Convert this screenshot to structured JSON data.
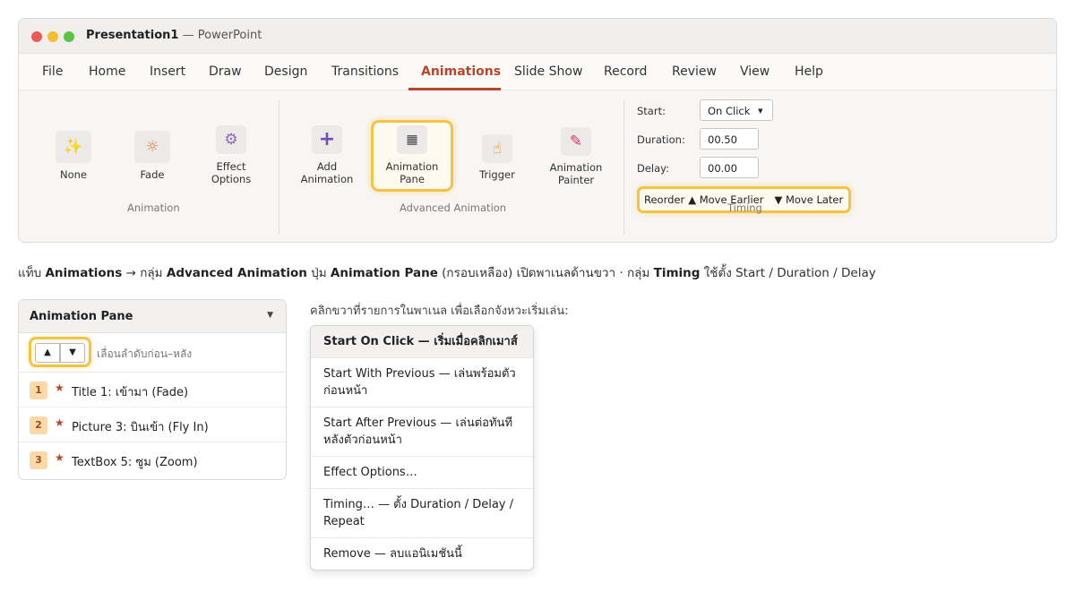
{
  "window": {
    "title": "Presentation1",
    "app_suffix": " — PowerPoint"
  },
  "tabs": [
    "File",
    "Home",
    "Insert",
    "Draw",
    "Design",
    "Transitions",
    "Animations",
    "Slide Show",
    "Record",
    "Review",
    "View",
    "Help"
  ],
  "active_tab": "Animations",
  "ribbon": {
    "animation_group": {
      "label": "Animation",
      "buttons": [
        {
          "label": "None",
          "icon": "sparkle-icon"
        },
        {
          "label": "Fade",
          "icon": "sun-icon"
        },
        {
          "label": "Effect Options",
          "icon": "gear-icon"
        }
      ]
    },
    "advanced_group": {
      "label": "Advanced Animation",
      "buttons": [
        {
          "label": "Add Animation",
          "icon": "plus-icon"
        },
        {
          "label": "Animation Pane",
          "icon": "grid-icon"
        },
        {
          "label": "Trigger",
          "icon": "hand-pointer-icon"
        },
        {
          "label": "Animation Painter",
          "icon": "brush-icon"
        }
      ]
    },
    "timing_group": {
      "label": "Timing",
      "start_label": "Start:",
      "start_value": "On Click",
      "duration_label": "Duration:",
      "duration_value": "00.50",
      "delay_label": "Delay:",
      "delay_value": "00.00",
      "reorder_label": "Reorder",
      "move_earlier": "▲ Move Earlier",
      "move_later": "▼ Move Later"
    }
  },
  "caption": {
    "p1": "แท็บ ",
    "b1": "Animations",
    "p2": " → กลุ่ม ",
    "b2": "Advanced Animation",
    "p3": " ปุ่ม ",
    "b3": "Animation Pane",
    "p4": " (กรอบเหลือง) เปิดพาเนลด้านขวา  ·  กลุ่ม ",
    "b4": "Timing",
    "p5": " ใช้ตั้ง Start / Duration / Delay"
  },
  "pane": {
    "title": "Animation Pane",
    "up": "▲",
    "down": "▼",
    "hint": "เลื่อนลำดับก่อน–หลัง",
    "items": [
      {
        "num": "1",
        "text": "Title 1: เข้ามา (Fade)"
      },
      {
        "num": "2",
        "text": "Picture 3: บินเข้า (Fly In)"
      },
      {
        "num": "3",
        "text": "TextBox 5: ซูม (Zoom)"
      }
    ]
  },
  "context_menu": {
    "label": "คลิกขวาที่รายการในพาเนล เพื่อเลือกจังหวะเริ่มเล่น:",
    "items": [
      "Start On Click — เริ่มเมื่อคลิกเมาส์",
      "Start With Previous — เล่นพร้อมตัวก่อนหน้า",
      "Start After Previous — เล่นต่อทันทีหลังตัวก่อนหน้า",
      "Effect Options…",
      "Timing… — ตั้ง Duration / Delay / Repeat",
      "Remove — ลบแอนิเมชันนี้"
    ]
  },
  "colors": {
    "accent": "#b7472a",
    "highlight": "#f5c344",
    "badge": "#fcd9a8"
  }
}
